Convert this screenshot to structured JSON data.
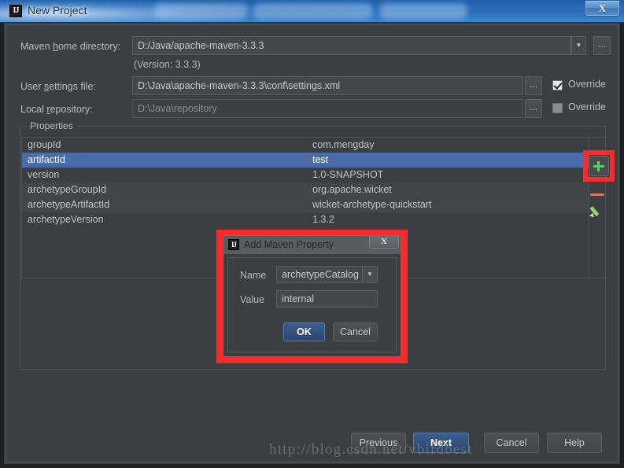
{
  "window": {
    "title": "New Project",
    "icon": "intellij-idea-icon",
    "close_label": "X",
    "background_blur_hint": "spring boot starter hello"
  },
  "form": {
    "maven_home": {
      "label": "Maven home directory:",
      "label_mnemonic": "h",
      "value": "D:/Java/apache-maven-3.3.3",
      "browse_label": "...",
      "version_note": "(Version: 3.3.3)"
    },
    "user_settings": {
      "label": "User settings file:",
      "label_mnemonic": "s",
      "value": "D:\\Java\\apache-maven-3.3.3\\conf\\settings.xml",
      "browse_label": "...",
      "override_label": "Override",
      "override_checked": true
    },
    "local_repository": {
      "label": "Local repository:",
      "label_mnemonic": "r",
      "value": "D:\\Java\\repository",
      "browse_label": "...",
      "override_label": "Override",
      "override_checked": false
    }
  },
  "properties": {
    "legend": "Properties",
    "rows": [
      {
        "key": "groupId",
        "value": "com.mengday",
        "selected": false
      },
      {
        "key": "artifactId",
        "value": "test",
        "selected": true
      },
      {
        "key": "version",
        "value": "1.0-SNAPSHOT",
        "selected": false
      },
      {
        "key": "archetypeGroupId",
        "value": "org.apache.wicket",
        "selected": false
      },
      {
        "key": "archetypeArtifactId",
        "value": "wicket-archetype-quickstart",
        "selected": false
      },
      {
        "key": "archetypeVersion",
        "value": "1.3.2",
        "selected": false
      }
    ],
    "toolbar": {
      "add_icon": "plus-icon",
      "remove_icon": "minus-icon",
      "edit_icon": "pencil-icon",
      "add_highlight_color": "#f92b2b"
    }
  },
  "footer": {
    "previous_label": "Previous",
    "next_label": "Next",
    "cancel_label": "Cancel",
    "help_label": "Help"
  },
  "watermark": {
    "text": "http://blog.csdn.net/vbirdbest"
  },
  "dialog": {
    "title": "Add Maven Property",
    "icon": "intellij-idea-icon",
    "close_label": "X",
    "highlight_color": "#f92b2b",
    "name": {
      "label": "Name",
      "value": "archetypeCatalog"
    },
    "value": {
      "label": "Value",
      "value": "internal"
    },
    "ok_label": "OK",
    "cancel_label": "Cancel"
  }
}
